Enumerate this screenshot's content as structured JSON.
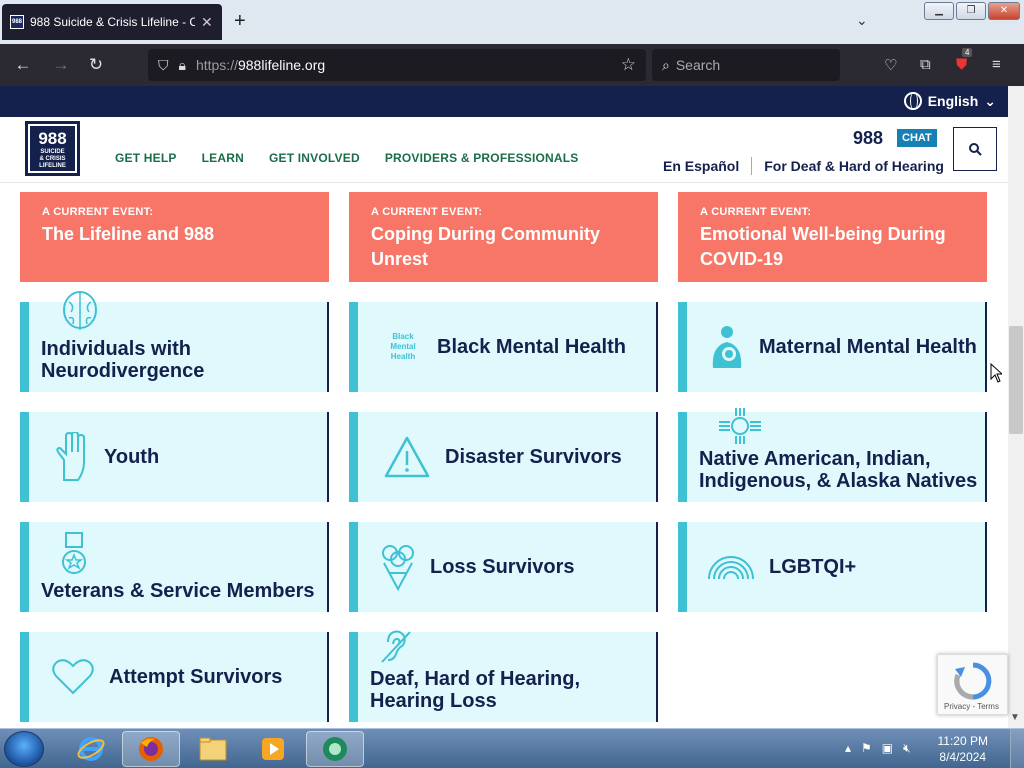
{
  "browser": {
    "tab_title": "988 Suicide & Crisis Lifeline - C",
    "tab_favicon_text": "988",
    "url_prefix": "https://",
    "url_host": "988lifeline.org",
    "search_placeholder": "Search",
    "ext_badge": "4"
  },
  "site": {
    "language": "English",
    "logo_number": "988",
    "logo_subtitle_1": "SUICIDE",
    "logo_subtitle_2": "& CRISIS",
    "logo_subtitle_3": "LIFELINE",
    "nav": [
      "GET HELP",
      "LEARN",
      "GET INVOLVED",
      "PROVIDERS & PROFESSIONALS"
    ],
    "phone": "988",
    "chat": "CHAT",
    "espanol": "En Español",
    "deaf_link": "For Deaf & Hard of Hearing"
  },
  "events": [
    {
      "kicker": "A CURRENT EVENT:",
      "title": "The Lifeline and 988"
    },
    {
      "kicker": "A CURRENT EVENT:",
      "title": "Coping During Community Unrest"
    },
    {
      "kicker": "A CURRENT EVENT:",
      "title": "Emotional Well-being During COVID-19"
    }
  ],
  "cards": [
    {
      "label": "Individuals with Neurodivergence",
      "icon": "brain-icon"
    },
    {
      "label": "Black Mental Health",
      "icon": "black-mental-health-icon",
      "icon_text": "Black Mental Health"
    },
    {
      "label": "Maternal Mental Health",
      "icon": "mother-child-icon"
    },
    {
      "label": "Youth",
      "icon": "hand-icon"
    },
    {
      "label": "Disaster Survivors",
      "icon": "warning-icon"
    },
    {
      "label": "Native American, Indian, Indigenous, & Alaska Natives",
      "icon": "zia-sun-icon"
    },
    {
      "label": "Veterans & Service Members",
      "icon": "medal-icon"
    },
    {
      "label": "Loss Survivors",
      "icon": "bouquet-icon"
    },
    {
      "label": "LGBTQI+",
      "icon": "rainbow-icon"
    },
    {
      "label": "Attempt Survivors",
      "icon": "heart-icon"
    },
    {
      "label": "Deaf, Hard of Hearing, Hearing Loss",
      "icon": "ear-icon"
    }
  ],
  "recaptcha_links": "Privacy - Terms",
  "taskbar": {
    "time": "11:20 PM",
    "date": "8/4/2024"
  },
  "colors": {
    "navy": "#14214d",
    "coral": "#f77667",
    "card_bg": "#dff9fd",
    "teal": "#3ec1d3",
    "nav_green": "#1b6d4a"
  }
}
